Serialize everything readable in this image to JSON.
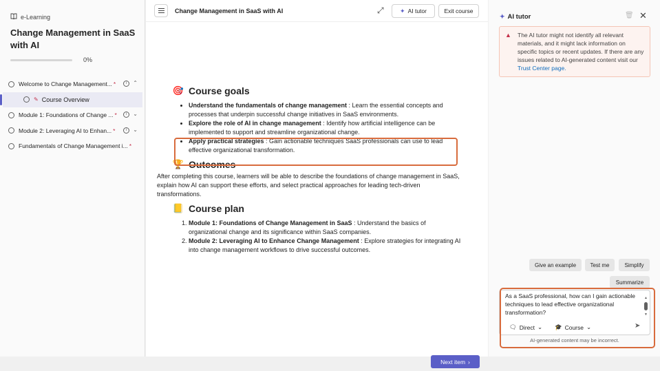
{
  "sidebar": {
    "brand": "e-Learning",
    "course_title": "Change Management in SaaS with AI",
    "progress_percent": 0,
    "progress_label": "0%",
    "items": [
      {
        "label": "Welcome to Change Management...",
        "required": "*",
        "chevron": "⌃"
      },
      {
        "label": "Course Overview"
      },
      {
        "label": "Module 1: Foundations of Change ...",
        "required": "*",
        "chevron": "⌄"
      },
      {
        "label": "Module 2: Leveraging AI to Enhan...",
        "required": "*",
        "chevron": "⌄"
      },
      {
        "label": "Fundamentals of Change Management i...",
        "required": "*"
      }
    ]
  },
  "main": {
    "title": "Change Management in SaaS with AI",
    "ai_tutor_label": "AI tutor",
    "exit_label": "Exit course",
    "next_label": "Next item",
    "goals_heading": "Course goals",
    "goals": [
      {
        "bold": "Understand the fundamentals of change management",
        "text": " : Learn the essential concepts and processes that underpin successful change initiatives in SaaS environments."
      },
      {
        "bold": "Explore the role of AI in change management",
        "text": " : Identify how artificial intelligence can be implemented to support and streamline organizational change."
      },
      {
        "bold": "Apply practical strategies",
        "text": " : Gain actionable techniques SaaS professionals can use to lead effective organizational transformation."
      }
    ],
    "outcomes_heading": "Outcomes",
    "outcomes_text": "After completing this course, learners will be able to describe the foundations of change management in SaaS, explain how AI can support these efforts, and select practical approaches for leading tech-driven transformations.",
    "plan_heading": "Course plan",
    "plan": [
      {
        "bold": "Module 1: Foundations of Change Management in SaaS",
        "text": " : Understand the basics of organizational change and its significance within SaaS companies."
      },
      {
        "bold": "Module 2: Leveraging AI to Enhance Change Management",
        "text": " : Explore strategies for integrating AI into change management workflows to drive successful outcomes."
      }
    ]
  },
  "panel": {
    "title": "AI tutor",
    "warning": "The AI tutor might not identify all relevant materials, and it might lack information on specific topics or recent updates. If there are any issues related to AI-generated content visit our ",
    "warning_link": "Trust Center page.",
    "chips": [
      "Give an example",
      "Test me",
      "Simplify",
      "Summarize"
    ],
    "composer_text": "As a SaaS professional, how can I gain actionable techniques to lead effective organizational transformation?",
    "mode_direct": "Direct",
    "mode_course": "Course",
    "disclaimer": "AI-generated content may be incorrect."
  },
  "colors": {
    "accent": "#5b5fc7",
    "highlight": "#d86b3c",
    "required": "#c4314b"
  }
}
